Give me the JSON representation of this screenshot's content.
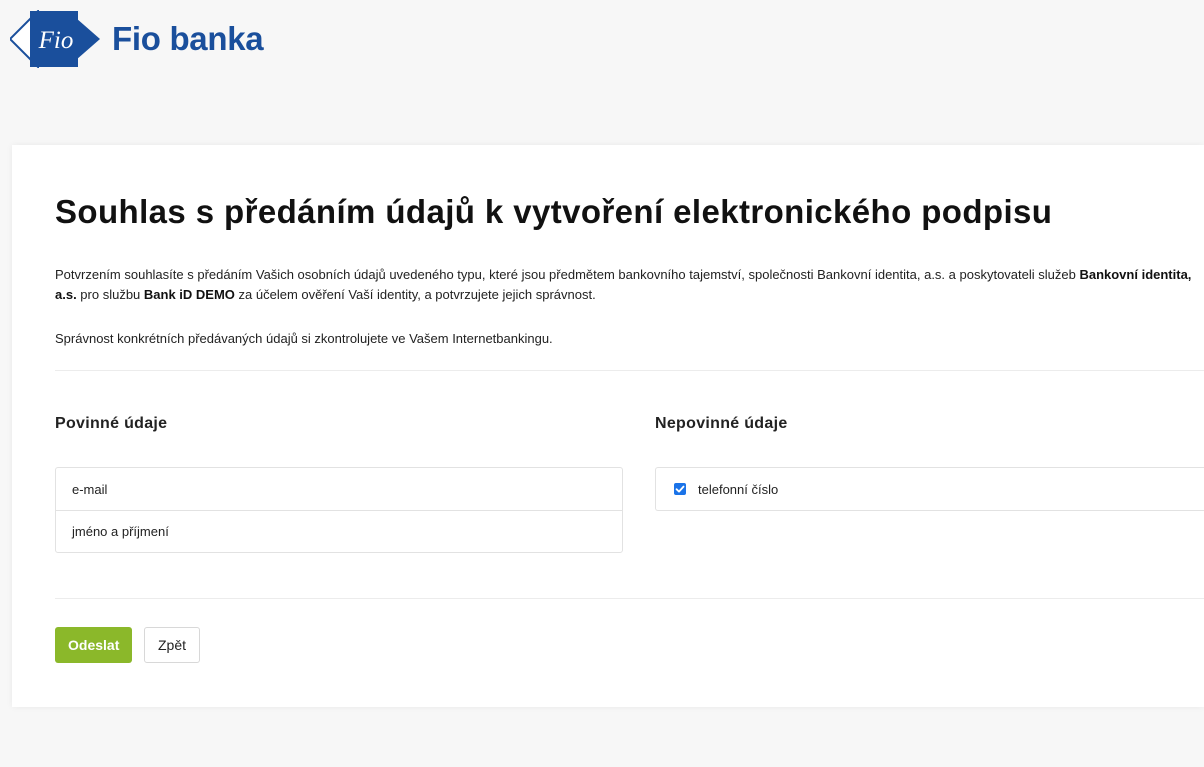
{
  "header": {
    "logo_mark_text": "Fio",
    "brand_name": "Fio banka",
    "brand_color": "#1a4f9c"
  },
  "consent": {
    "title": "Souhlas s předáním údajů k vytvoření elektronického podpisu",
    "paragraph1_part1": "Potvrzením souhlasíte s předáním Vašich osobních údajů uvedeného typu, které jsou předmětem bankovního tajemství, společnosti Bankovní identita, a.s. a poskytovateli služeb ",
    "paragraph1_bold1": "Bankovní identita, a.s.",
    "paragraph1_part2": " pro službu ",
    "paragraph1_bold2": "Bank iD DEMO",
    "paragraph1_part3": " za účelem ověření Vaší identity, a potvrzujete jejich správnost.",
    "paragraph2": "Správnost konkrétních předávaných údajů si zkontrolujete ve Vašem Internetbankingu."
  },
  "required": {
    "heading": "Povinné údaje",
    "items": [
      {
        "label": "e-mail"
      },
      {
        "label": "jméno a příjmení"
      }
    ]
  },
  "optional": {
    "heading": "Nepovinné údaje",
    "items": [
      {
        "label": "telefonní číslo",
        "checked": true
      }
    ]
  },
  "actions": {
    "submit_label": "Odeslat",
    "back_label": "Zpět",
    "submit_color": "#8bb82a",
    "checkbox_color": "#1a73e8"
  }
}
